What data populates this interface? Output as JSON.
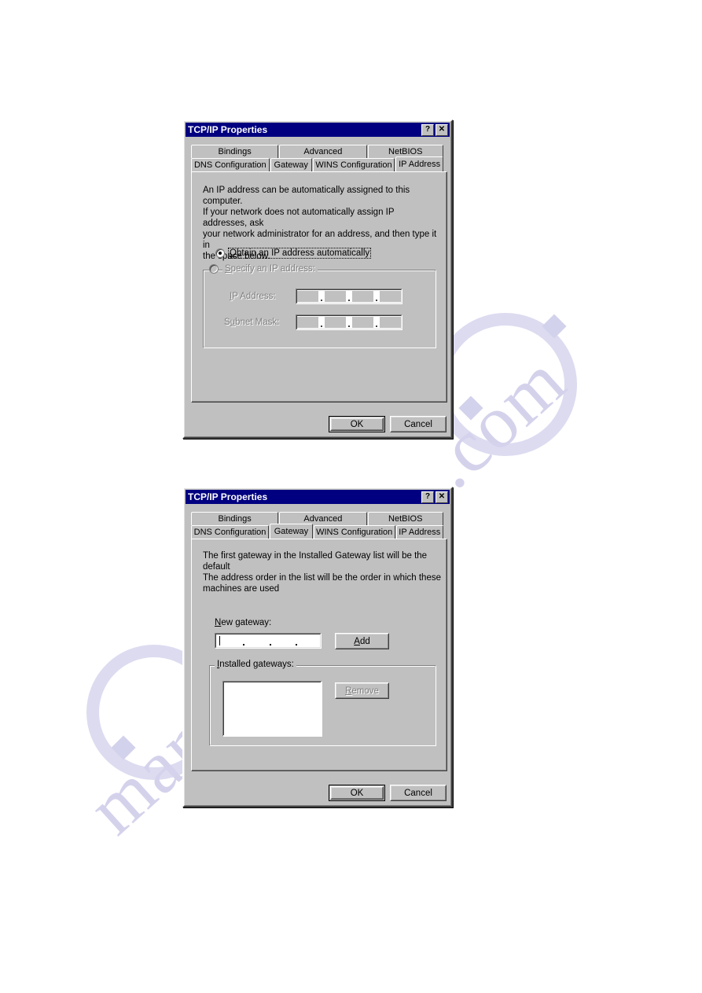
{
  "page": {
    "watermark": {
      "left_text": "manuals",
      "right_text": ".com"
    }
  },
  "dialogs": [
    {
      "id": "ip-address",
      "title": "TCP/IP Properties",
      "title_buttons": {
        "help": "?",
        "close": "✕"
      },
      "tabs_row1": [
        {
          "label": "Bindings",
          "active": false
        },
        {
          "label": "Advanced",
          "active": false
        },
        {
          "label": "NetBIOS",
          "active": false
        }
      ],
      "tabs_row2": [
        {
          "label": "DNS Configuration",
          "active": false
        },
        {
          "label": "Gateway",
          "active": false
        },
        {
          "label": "WINS Configuration",
          "active": false
        },
        {
          "label": "IP Address",
          "active": true
        }
      ],
      "description": "An IP address can be automatically assigned to this computer.\nIf your network does not automatically assign IP addresses, ask\nyour network administrator for an address, and then type it in\nthe space below.",
      "radio_obtain": {
        "label_before": "",
        "label_accel": "O",
        "label_after": "btain an IP address automatically",
        "checked": true,
        "focused": true
      },
      "group_specify": {
        "title_accel": "S",
        "title_before": "",
        "title_after": "pecify an IP address:",
        "enabled": false,
        "fields": [
          {
            "label_accel": "I",
            "label_before": "",
            "label_after": "P Address:",
            "value": "",
            "enabled": false
          },
          {
            "label_accel": "u",
            "label_before": "S",
            "label_after": "bnet Mask:",
            "value": "",
            "enabled": false
          }
        ]
      },
      "buttons": [
        {
          "label": "OK",
          "default": true,
          "disabled": false
        },
        {
          "label": "Cancel",
          "default": false,
          "disabled": false
        }
      ]
    },
    {
      "id": "gateway",
      "title": "TCP/IP Properties",
      "title_buttons": {
        "help": "?",
        "close": "✕"
      },
      "tabs_row1": [
        {
          "label": "Bindings",
          "active": false
        },
        {
          "label": "Advanced",
          "active": false
        },
        {
          "label": "NetBIOS",
          "active": false
        }
      ],
      "tabs_row2": [
        {
          "label": "DNS Configuration",
          "active": false
        },
        {
          "label": "Gateway",
          "active": true
        },
        {
          "label": "WINS Configuration",
          "active": false
        },
        {
          "label": "IP Address",
          "active": false
        }
      ],
      "description": "The first gateway in the Installed Gateway list will be the default\nThe address order in the list will be the order in which these\nmachines are used",
      "new_gateway": {
        "label_accel": "N",
        "label_before": "",
        "label_after": "ew gateway:",
        "value": "",
        "enabled": true,
        "focused": true,
        "add_button": {
          "label_accel": "A",
          "label_before": "",
          "label_after": "dd",
          "disabled": false
        }
      },
      "group_installed": {
        "title_accel": "I",
        "title_before": "",
        "title_after": "nstalled gateways:",
        "items": [],
        "remove_button": {
          "label_accel": "R",
          "label_before": "",
          "label_after": "emove",
          "disabled": true
        }
      },
      "buttons": [
        {
          "label": "OK",
          "default": true,
          "disabled": false
        },
        {
          "label": "Cancel",
          "default": false,
          "disabled": false
        }
      ]
    }
  ]
}
